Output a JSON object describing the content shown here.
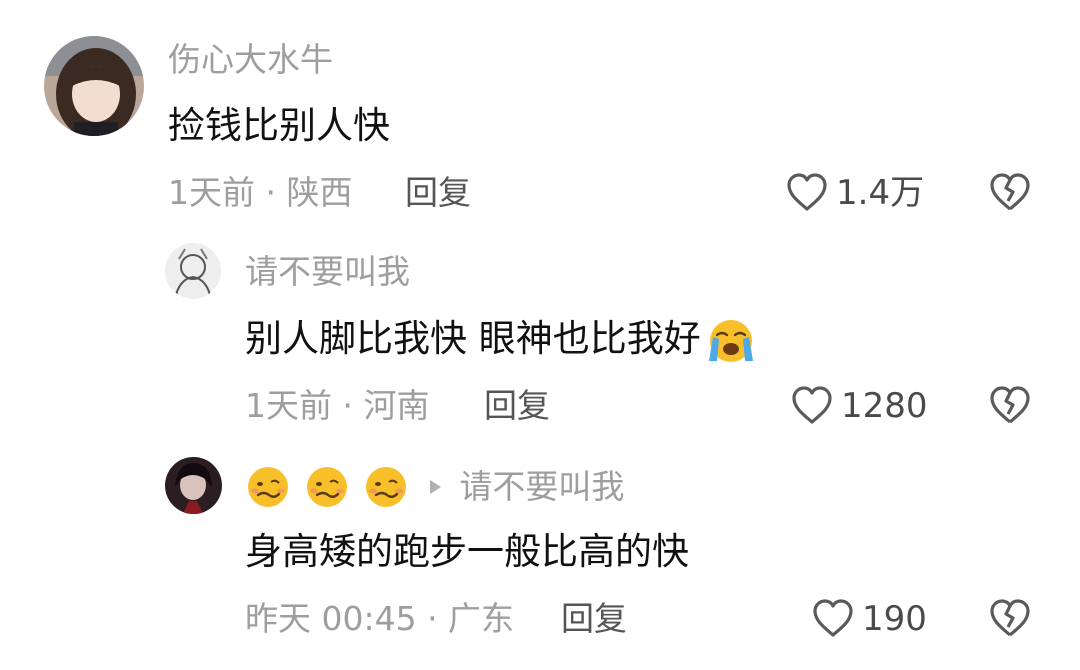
{
  "comments": [
    {
      "username": "伤心大水牛",
      "content": "捡钱比别人快",
      "meta": "1天前 · 陕西",
      "reply_label": "回复",
      "likes": "1.4万"
    },
    {
      "username": "请不要叫我",
      "content": "别人脚比我快 眼神也比我好",
      "meta": "1天前 · 河南",
      "reply_label": "回复",
      "likes": "1280"
    },
    {
      "reply_to": "请不要叫我",
      "content": "身高矮的跑步一般比高的快",
      "meta": "昨天 00:45 · 广东",
      "reply_label": "回复",
      "likes": "190"
    }
  ],
  "icons": {
    "like": "heart-outline-icon",
    "dislike": "broken-heart-icon",
    "crying_emoji": "loudly-crying-face-icon",
    "username_emoji": "woozy-face-icon",
    "reply_arrow": "play-triangle-icon"
  },
  "colors": {
    "text_primary": "#111111",
    "text_secondary": "#9e9e9e",
    "icon_gray": "#5a5a5a",
    "emoji_yellow": "#f7c02b"
  }
}
